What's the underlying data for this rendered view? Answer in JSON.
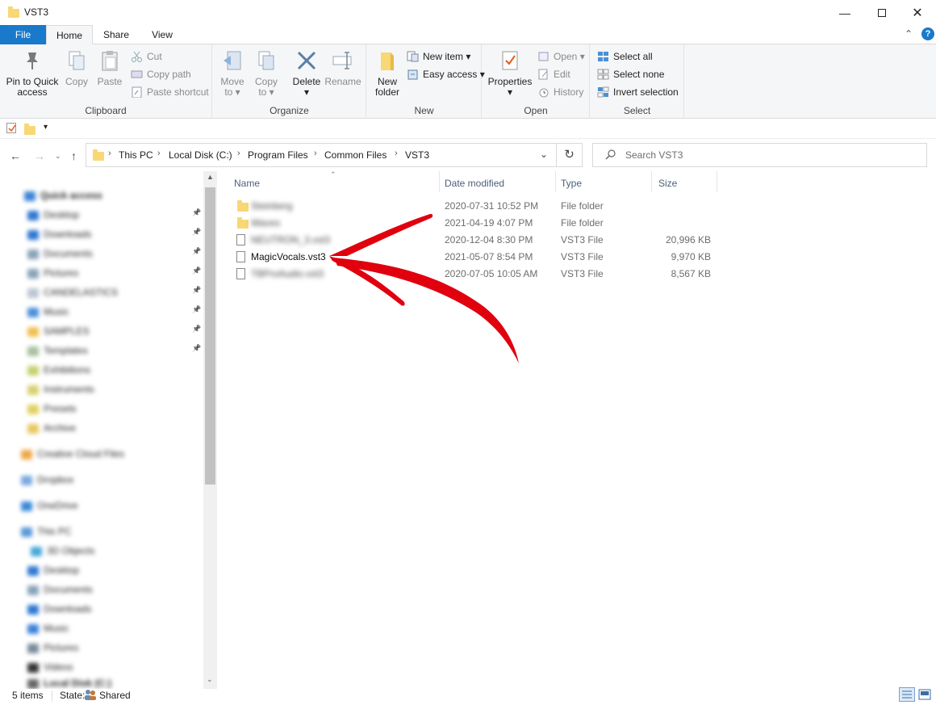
{
  "window": {
    "title": "VST3"
  },
  "tabs": {
    "file": "File",
    "home": "Home",
    "share": "Share",
    "view": "View"
  },
  "ribbon": {
    "clipboard": {
      "label": "Clipboard",
      "pin1": "Pin to Quick",
      "pin2": "access",
      "copy": "Copy",
      "paste": "Paste",
      "cut": "Cut",
      "copy_path": "Copy path",
      "paste_shortcut": "Paste shortcut"
    },
    "organize": {
      "label": "Organize",
      "move1": "Move",
      "move2": "to",
      "copy1": "Copy",
      "copy2": "to",
      "delete": "Delete",
      "rename": "Rename"
    },
    "new": {
      "label": "New",
      "folder1": "New",
      "folder2": "folder",
      "new_item": "New item",
      "easy_access": "Easy access"
    },
    "open": {
      "label": "Open",
      "properties": "Properties",
      "open": "Open",
      "edit": "Edit",
      "history": "History"
    },
    "select": {
      "label": "Select",
      "all": "Select all",
      "none": "Select none",
      "invert": "Invert selection"
    }
  },
  "address": {
    "crumbs": [
      "This PC",
      "Local Disk (C:)",
      "Program Files",
      "Common Files",
      "VST3"
    ]
  },
  "search": {
    "placeholder": "Search VST3"
  },
  "sidebar": {
    "items": [
      "Quick access",
      "Desktop",
      "Downloads",
      "Documents",
      "Pictures",
      "CANDELASTICS",
      "Music",
      "SAMPLES",
      "Templates",
      "Exhibitions",
      "Instruments",
      "Presets",
      "Archive",
      "Creative Cloud Files",
      "Dropbox",
      "OneDrive",
      "This PC",
      "3D Objects",
      "Desktop",
      "Documents",
      "Downloads",
      "Music",
      "Pictures",
      "Videos",
      "Local Disk (C:)"
    ]
  },
  "columns": {
    "name": "Name",
    "date": "Date modified",
    "type": "Type",
    "size": "Size"
  },
  "files": [
    {
      "name": "Steinberg",
      "date": "2020-07-31 10:52 PM",
      "type": "File folder",
      "size": "",
      "kind": "folder",
      "blurred": true
    },
    {
      "name": "Waves",
      "date": "2021-04-19 4:07 PM",
      "type": "File folder",
      "size": "",
      "kind": "folder",
      "blurred": true
    },
    {
      "name": "NEUTRON_3.vst3",
      "date": "2020-12-04 8:30 PM",
      "type": "VST3 File",
      "size": "20,996 KB",
      "kind": "file",
      "blurred": true
    },
    {
      "name": "MagicVocals.vst3",
      "date": "2021-05-07 8:54 PM",
      "type": "VST3 File",
      "size": "9,970 KB",
      "kind": "file",
      "blurred": false
    },
    {
      "name": "TBProAudio.vst3",
      "date": "2020-07-05 10:05 AM",
      "type": "VST3 File",
      "size": "8,567 KB",
      "kind": "file",
      "blurred": true
    }
  ],
  "status": {
    "items": "5 items",
    "state_label": "State:",
    "state_value": "Shared"
  },
  "colors": {
    "accent": "#1979ca",
    "arrow": "#e0000e",
    "folder": "#f8d775"
  }
}
